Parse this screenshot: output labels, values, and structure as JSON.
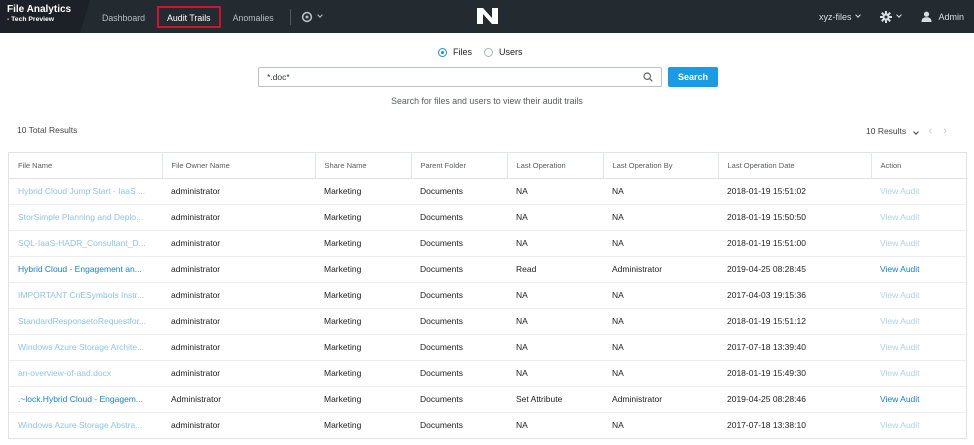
{
  "app": {
    "title": "File Analytics",
    "subtitle": "- Tech Preview"
  },
  "nav": {
    "items": [
      {
        "label": "Dashboard",
        "active": false
      },
      {
        "label": "Audit Trails",
        "active": true
      },
      {
        "label": "Anomalies",
        "active": false
      }
    ],
    "settings_icon": "gear-icon",
    "logo_icon": "nutanix-logo-icon"
  },
  "header_right": {
    "cluster": "xyz-files",
    "user": "Admin",
    "settings_icon": "gear-icon",
    "user_icon": "user-icon"
  },
  "search": {
    "modes": [
      {
        "label": "Files",
        "selected": true
      },
      {
        "label": "Users",
        "selected": false
      }
    ],
    "value": "*.doc*",
    "button_label": "Search",
    "hint": "Search for files and users to view their audit trails"
  },
  "results": {
    "total": "10 Total Results",
    "per_page": "10 Results"
  },
  "table": {
    "columns": [
      "File Name",
      "File Owner Name",
      "Share Name",
      "Parent Folder",
      "Last Operation",
      "Last Operation By",
      "Last Operation Date",
      "Action"
    ],
    "rows": [
      {
        "file": "Hybrid Cloud Jump Start - IaaS ...",
        "owner": "administrator",
        "share": "Marketing",
        "folder": "Documents",
        "op": "NA",
        "by": "NA",
        "date": "2018-01-19 15:51:02",
        "action": "View Audit",
        "active": false
      },
      {
        "file": "StorSimple Planning and Deplo...",
        "owner": "administrator",
        "share": "Marketing",
        "folder": "Documents",
        "op": "NA",
        "by": "NA",
        "date": "2018-01-19 15:50:50",
        "action": "View Audit",
        "active": false
      },
      {
        "file": "SQL-IaaS-HADR_Consultant_D...",
        "owner": "administrator",
        "share": "Marketing",
        "folder": "Documents",
        "op": "NA",
        "by": "NA",
        "date": "2018-01-19 15:51:00",
        "action": "View Audit",
        "active": false
      },
      {
        "file": "Hybrid Cloud - Engagement an...",
        "owner": "administrator",
        "share": "Marketing",
        "folder": "Documents",
        "op": "Read",
        "by": "Administrator",
        "date": "2019-04-25 08:28:45",
        "action": "View Audit",
        "active": true
      },
      {
        "file": "IMPORTANT CnESymbols Instr...",
        "owner": "administrator",
        "share": "Marketing",
        "folder": "Documents",
        "op": "NA",
        "by": "NA",
        "date": "2017-04-03 19:15:36",
        "action": "View Audit",
        "active": false
      },
      {
        "file": "StandardResponsetoRequestfor...",
        "owner": "administrator",
        "share": "Marketing",
        "folder": "Documents",
        "op": "NA",
        "by": "NA",
        "date": "2018-01-19 15:51:12",
        "action": "View Audit",
        "active": false
      },
      {
        "file": "Windows Azure Storage Archite...",
        "owner": "administrator",
        "share": "Marketing",
        "folder": "Documents",
        "op": "NA",
        "by": "NA",
        "date": "2017-07-18 13:39:40",
        "action": "View Audit",
        "active": false
      },
      {
        "file": "an-overview-of-aad.docx",
        "owner": "administrator",
        "share": "Marketing",
        "folder": "Documents",
        "op": "NA",
        "by": "NA",
        "date": "2018-01-19 15:49:30",
        "action": "View Audit",
        "active": false
      },
      {
        "file": ".~lock.Hybrid Cloud - Engagem...",
        "owner": "Administrator",
        "share": "Marketing",
        "folder": "Documents",
        "op": "Set Attribute",
        "by": "Administrator",
        "date": "2019-04-25 08:28:46",
        "action": "View Audit",
        "active": true
      },
      {
        "file": "Windows Azure Storage Abstra...",
        "owner": "administrator",
        "share": "Marketing",
        "folder": "Documents",
        "op": "NA",
        "by": "NA",
        "date": "2017-07-18 13:38:10",
        "action": "View Audit",
        "active": false
      }
    ]
  }
}
